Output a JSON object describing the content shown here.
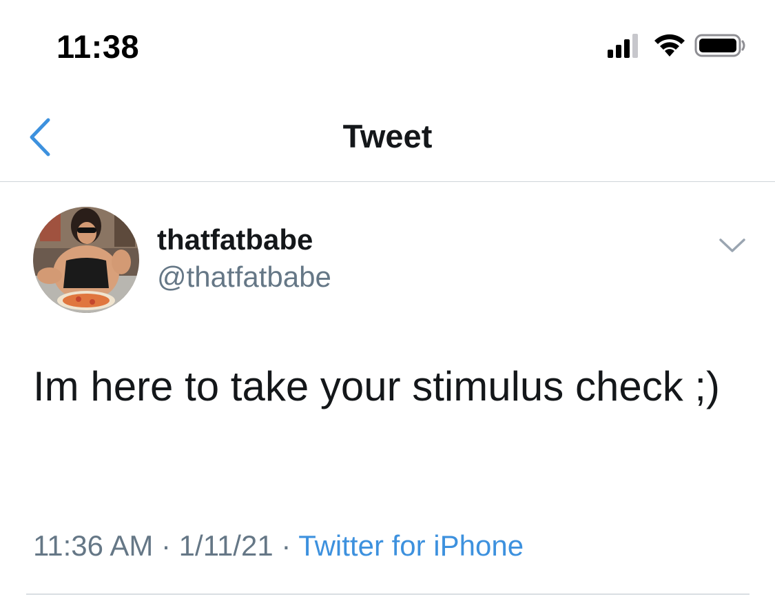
{
  "status_bar": {
    "time": "11:38",
    "icons": [
      "signal-icon",
      "wifi-icon",
      "battery-icon"
    ]
  },
  "nav": {
    "title": "Tweet",
    "back_icon": "chevron-left-icon"
  },
  "tweet": {
    "display_name": "thatfatbabe",
    "handle": "@thatfatbabe",
    "text": "Im here to take your stimulus check ;)",
    "time": "11:36 AM",
    "separator": " · ",
    "date": "1/11/21",
    "source": "Twitter for iPhone",
    "more_icon": "chevron-down-icon"
  },
  "colors": {
    "accent": "#3d91de",
    "text_primary": "#14171a",
    "text_secondary": "#657786",
    "divider": "#d9dee2"
  }
}
